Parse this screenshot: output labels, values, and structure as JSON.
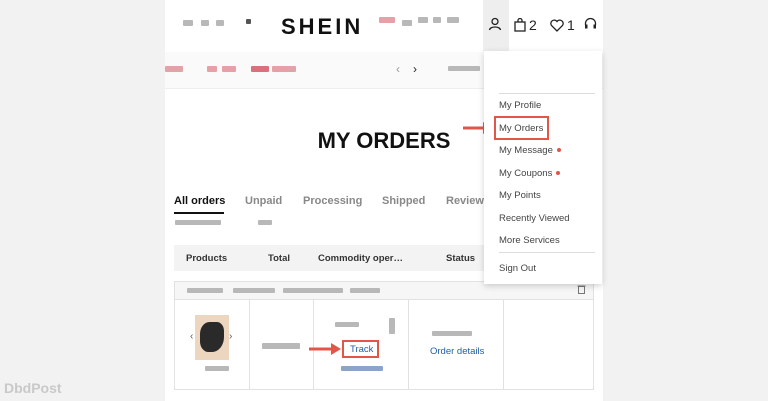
{
  "header": {
    "logo": "SHEIN",
    "cart_count": "2",
    "wishlist_count": "1"
  },
  "page_title": "MY ORDERS",
  "tabs": [
    {
      "label": "All orders",
      "active": true
    },
    {
      "label": "Unpaid"
    },
    {
      "label": "Processing"
    },
    {
      "label": "Shipped"
    },
    {
      "label": "Review"
    }
  ],
  "table": {
    "headers": [
      "Products",
      "Total",
      "Commodity oper…",
      "Status"
    ]
  },
  "order": {
    "track_label": "Track",
    "details_label": "Order details"
  },
  "dropdown": {
    "items": [
      {
        "label": "My Profile"
      },
      {
        "label": "My Orders",
        "highlighted": true
      },
      {
        "label": "My Message",
        "dot": true
      },
      {
        "label": "My Coupons",
        "dot": true
      },
      {
        "label": "My Points"
      },
      {
        "label": "Recently Viewed"
      },
      {
        "label": "More Services"
      },
      {
        "label": "Sign Out"
      }
    ]
  },
  "watermark": "DbdPost",
  "colors": {
    "accent_red": "#e0574a",
    "link_blue": "#1f5fa8"
  }
}
